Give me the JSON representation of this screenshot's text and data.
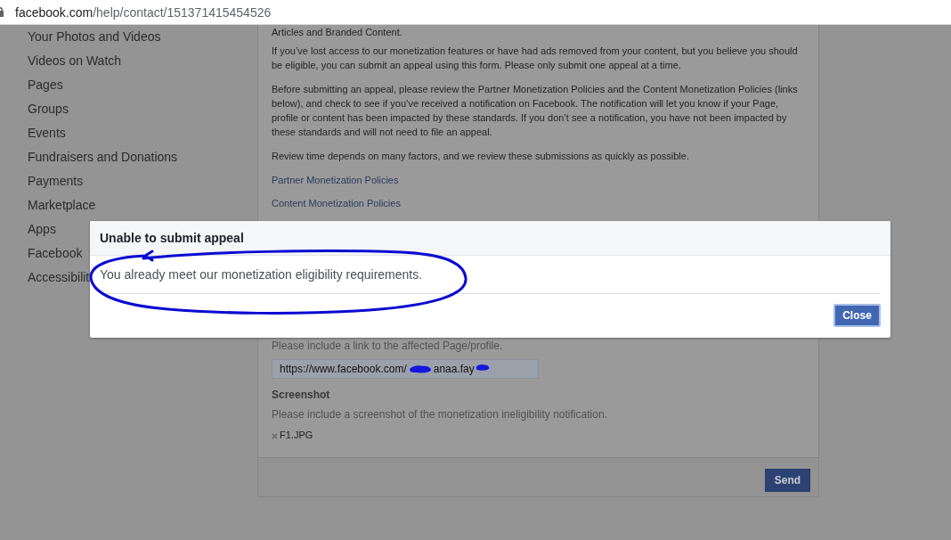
{
  "address_bar": {
    "host": "facebook.com",
    "path": "/help/contact/151371415454526"
  },
  "sidebar": {
    "items": [
      "Your Photos and Videos",
      "Videos on Watch",
      "Pages",
      "Groups",
      "Events",
      "Fundraisers and Donations",
      "Payments",
      "Marketplace",
      "Apps",
      "Facebook",
      "Accessibilit"
    ]
  },
  "form": {
    "paragraphs": [
      "Articles and Branded Content.",
      "If you’ve lost access to our monetization features or have had ads removed from your content, but you believe you should be eligible, you can submit an appeal using this form. Please only submit one appeal at a time.",
      "Before submitting an appeal, please review the Partner Monetization Policies and the Content Monetization Policies (links below), and check to see if you’ve received a notification on Facebook. The notification will let you know if your Page, profile or content has been impacted by these standards. If you don’t see a notification, you have not been impacted by these standards and will not need to file an appeal.",
      "Review time depends on many factors, and we review these submissions as quickly as possible."
    ],
    "links": [
      "Partner Monetization Policies",
      "Content Monetization Policies"
    ],
    "link_field": {
      "label": "Please include a link to the affected Page/profile.",
      "value": [
        {
          "kind": "text",
          "text": "https://www.facebook.com/"
        },
        {
          "kind": "redaction"
        },
        {
          "kind": "text",
          "text": "anaa.fay"
        },
        {
          "kind": "redaction"
        }
      ]
    },
    "screenshot": {
      "title": "Screenshot",
      "description": "Please include a screenshot of the monetization ineligibility notification.",
      "files": [
        "F1.JPG"
      ]
    },
    "submit_button": "Send"
  },
  "dialog": {
    "title": "Unable to submit appeal",
    "message": "You already meet our monetization eligibility requirements.",
    "message_circled": true,
    "close_button": {
      "label": "Close",
      "focused": true
    }
  }
}
